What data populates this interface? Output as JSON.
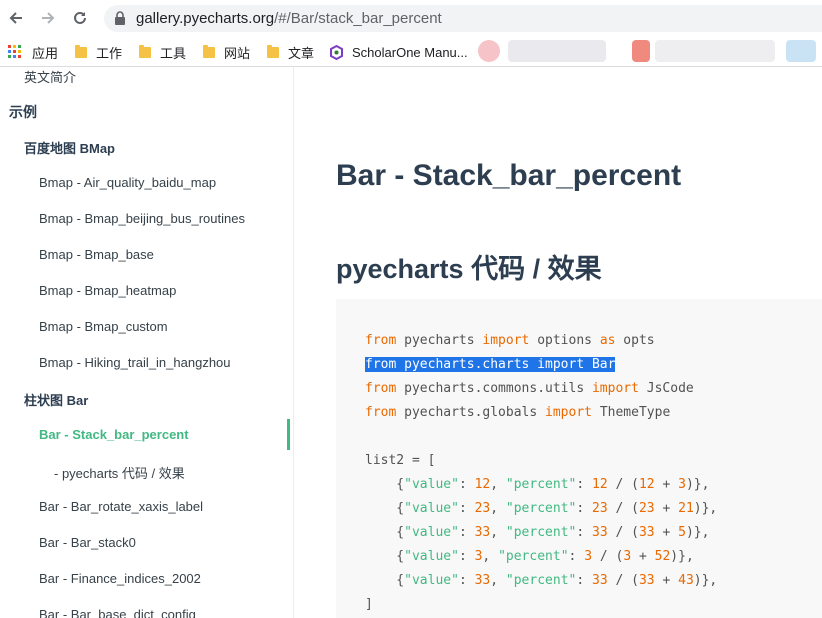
{
  "browser": {
    "url_host": "gallery.pyecharts.org",
    "url_path": "/#/Bar/stack_bar_percent",
    "bookmarks": [
      {
        "label": "应用",
        "icon": "apps-grid-icon"
      },
      {
        "label": "工作",
        "icon": "folder-icon"
      },
      {
        "label": "工具",
        "icon": "folder-icon"
      },
      {
        "label": "网站",
        "icon": "folder-icon"
      },
      {
        "label": "文章",
        "icon": "folder-icon"
      },
      {
        "label": "ScholarOne Manu...",
        "icon": "scholarone-icon"
      }
    ]
  },
  "sidebar": {
    "items": [
      {
        "label": "英文简介",
        "level": 1
      },
      {
        "label": "示例",
        "level": 0
      },
      {
        "label": "百度地图 BMap",
        "level": 1
      },
      {
        "label": "Bmap - Air_quality_baidu_map",
        "level": 2
      },
      {
        "label": "Bmap - Bmap_beijing_bus_routines",
        "level": 2
      },
      {
        "label": "Bmap - Bmap_base",
        "level": 2
      },
      {
        "label": "Bmap - Bmap_heatmap",
        "level": 2
      },
      {
        "label": "Bmap - Bmap_custom",
        "level": 2
      },
      {
        "label": "Bmap - Hiking_trail_in_hangzhou",
        "level": 2
      },
      {
        "label": "柱状图 Bar",
        "level": 1
      },
      {
        "label": "Bar - Stack_bar_percent",
        "level": 2,
        "active": true
      },
      {
        "label": "- pyecharts 代码 / 效果",
        "level": 3
      },
      {
        "label": "Bar - Bar_rotate_xaxis_label",
        "level": 2
      },
      {
        "label": "Bar - Bar_stack0",
        "level": 2
      },
      {
        "label": "Bar - Finance_indices_2002",
        "level": 2
      },
      {
        "label": "Bar - Bar_base_dict_config",
        "level": 2
      }
    ]
  },
  "content": {
    "title": "Bar - Stack_bar_percent",
    "subtitle": "pyecharts 代码 / 效果"
  },
  "code": {
    "l1": {
      "a": "from",
      "b": " pyecharts ",
      "c": "import",
      "d": " options ",
      "e": "as",
      "f": " opts"
    },
    "l2": "from pyecharts.charts import Bar",
    "l3": {
      "a": "from",
      "b": " pyecharts.commons.utils ",
      "c": "import",
      "d": " JsCode"
    },
    "l4": {
      "a": "from",
      "b": " pyecharts.globals ",
      "c": "import",
      "d": " ThemeType"
    },
    "l5": "list2 = [",
    "rows": [
      {
        "v": "12",
        "p": "12",
        "a": "12",
        "b": "3"
      },
      {
        "v": "23",
        "p": "23",
        "a": "23",
        "b": "21"
      },
      {
        "v": "33",
        "p": "33",
        "a": "33",
        "b": "5"
      },
      {
        "v": "3",
        "p": "3",
        "a": "3",
        "b": "52"
      },
      {
        "v": "33",
        "p": "33",
        "a": "33",
        "b": "43"
      }
    ],
    "key_value": "\"value\"",
    "key_percent": "\"percent\"",
    "close": "]"
  },
  "colors": {
    "accent": "#42b983",
    "keyword": "#e96900",
    "selection": "#1f74e8"
  }
}
